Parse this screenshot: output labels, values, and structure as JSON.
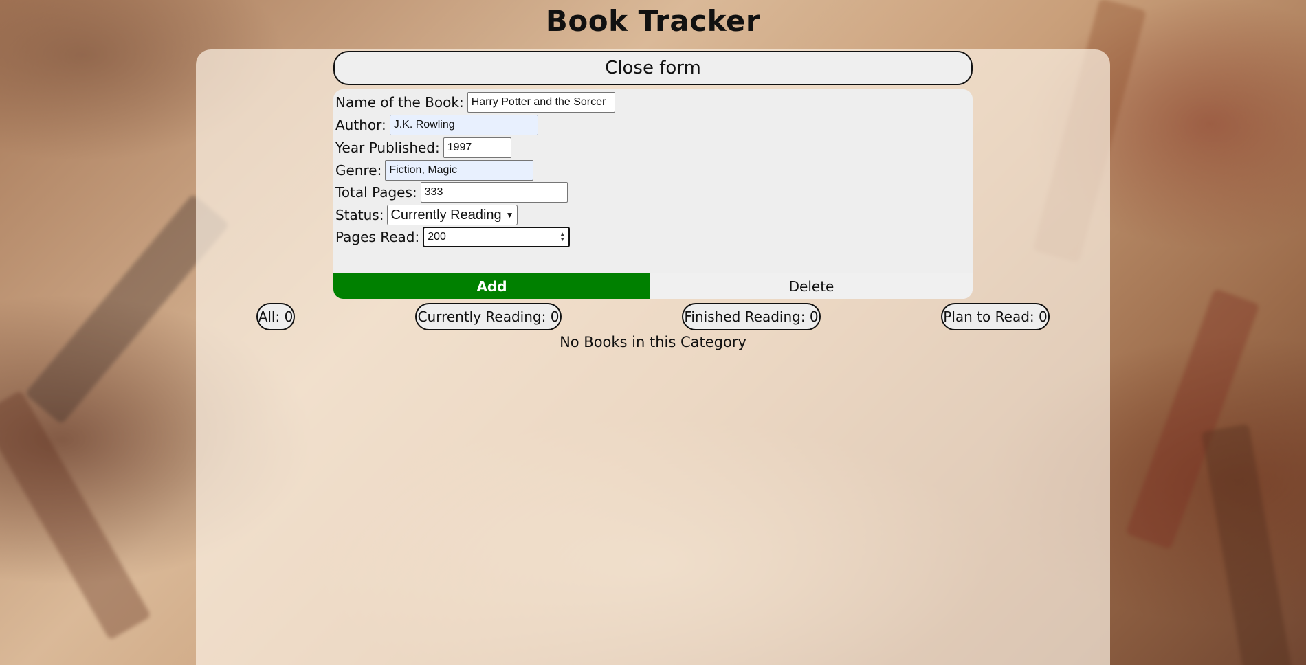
{
  "app": {
    "title": "Book Tracker"
  },
  "form_toggle": {
    "label": "Close form"
  },
  "form": {
    "name": {
      "label": "Name of the Book:",
      "value": "Harry Potter and the Sorcer"
    },
    "author": {
      "label": "Author:",
      "value": "J.K. Rowling"
    },
    "year": {
      "label": "Year Published:",
      "value": "1997"
    },
    "genre": {
      "label": "Genre:",
      "value": "Fiction, Magic"
    },
    "pages": {
      "label": "Total Pages:",
      "value": "333"
    },
    "status": {
      "label": "Status:",
      "value": "Currently Reading"
    },
    "pages_read": {
      "label": "Pages Read:",
      "value": "200"
    },
    "add_label": "Add",
    "delete_label": "Delete"
  },
  "filters": {
    "all": "All: 0",
    "currently_reading": "Currently Reading: 0",
    "finished_reading": "Finished Reading: 0",
    "plan_to_read": "Plan to Read: 0"
  },
  "empty_message": "No Books in this Category",
  "colors": {
    "add_button": "#008000",
    "panel": "#f5e9dd"
  }
}
